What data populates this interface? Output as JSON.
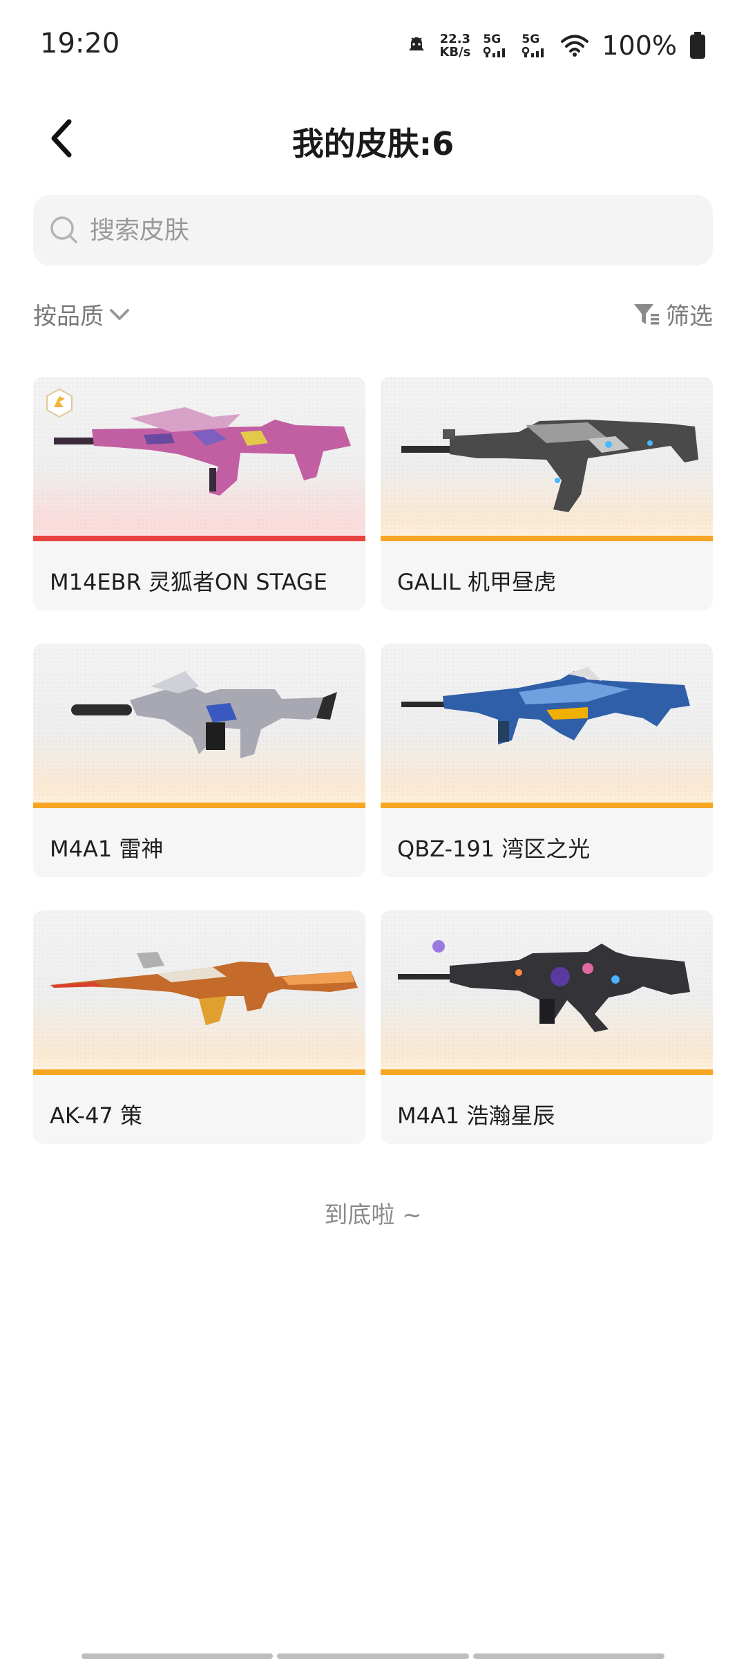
{
  "status_bar": {
    "time": "19:20",
    "net_speed_value": "22.3",
    "net_speed_unit": "KB/s",
    "sim1": "5G",
    "sim2": "5G",
    "battery": "100%"
  },
  "header": {
    "title": "我的皮肤:6"
  },
  "search": {
    "placeholder": "搜索皮肤",
    "value": ""
  },
  "filters": {
    "sort_label": "按品质",
    "filter_label": "筛选"
  },
  "skins": [
    {
      "name": "M14EBR 灵狐者ON STAGE",
      "quality_color": "#e8423f"
    },
    {
      "name": "GALIL 机甲昼虎",
      "quality_color": "#f6a623"
    },
    {
      "name": "M4A1 雷神",
      "quality_color": "#f6a623"
    },
    {
      "name": "QBZ-191 湾区之光",
      "quality_color": "#f6a623"
    },
    {
      "name": "AK-47 策",
      "quality_color": "#f6a623"
    },
    {
      "name": "M4A1 浩瀚星辰",
      "quality_color": "#f6a623"
    }
  ],
  "footer": {
    "end_text": "到底啦 ~"
  },
  "icons": [
    "back-arrow-icon",
    "search-icon",
    "chevron-down-icon",
    "filter-icon",
    "wifi-icon",
    "battery-icon",
    "notification-icon"
  ]
}
